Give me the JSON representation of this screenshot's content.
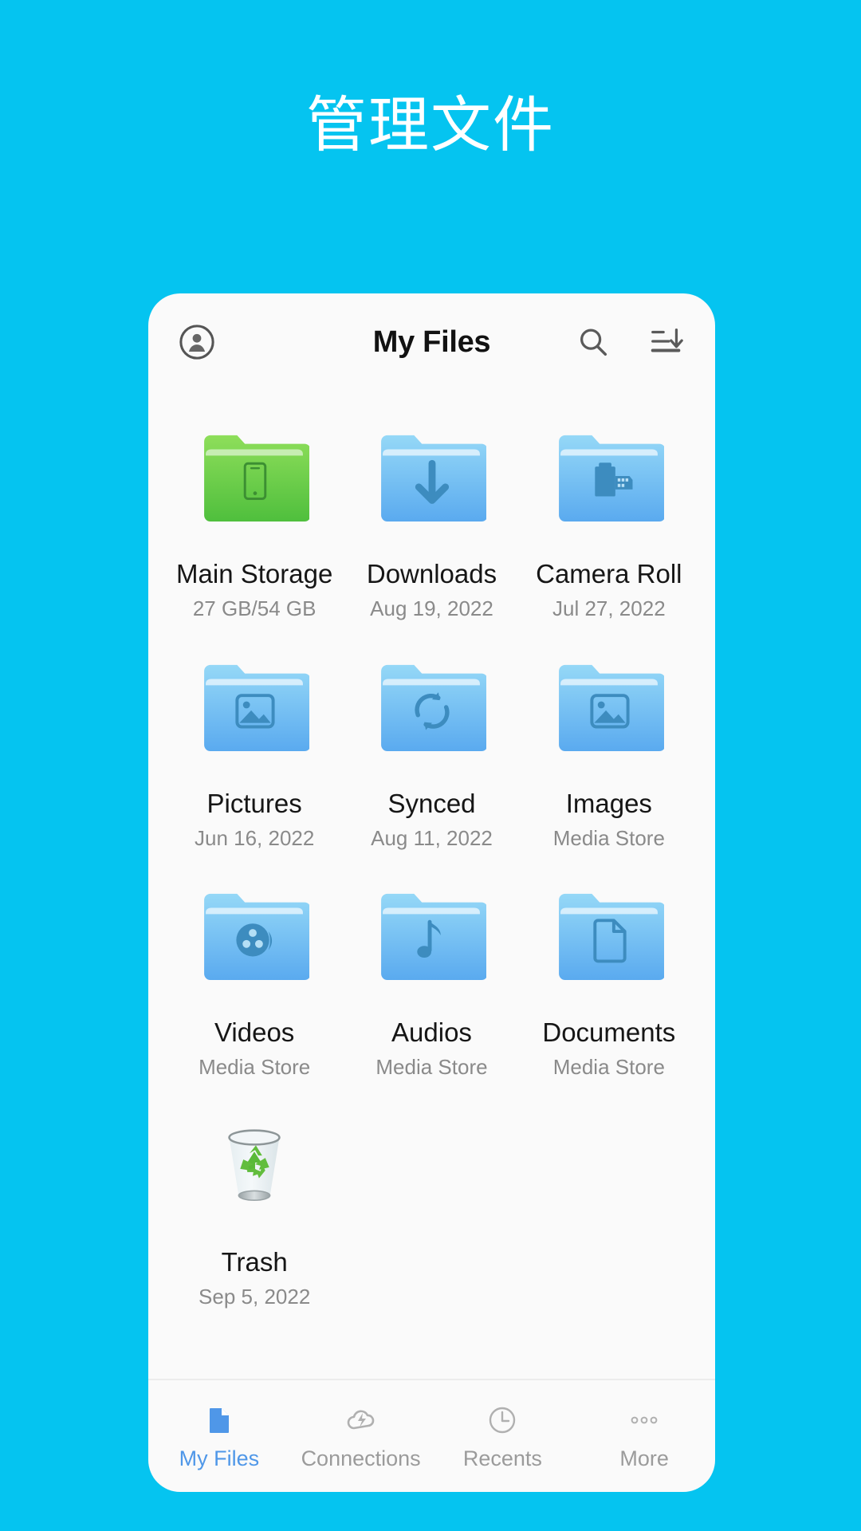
{
  "page": {
    "background_color": "#05c4f0",
    "hero_title": "管理文件"
  },
  "app_bar": {
    "avatar_icon": "account-circle-icon",
    "title": "My Files",
    "search_icon": "search-icon",
    "sort_icon": "sort-descending-icon"
  },
  "files": [
    {
      "name": "Main Storage",
      "sub": "27 GB/54 GB",
      "icon": "folder-phone-icon",
      "accent": "#5fc24a"
    },
    {
      "name": "Downloads",
      "sub": "Aug 19, 2022",
      "icon": "folder-download-icon",
      "accent": "#66b8ef"
    },
    {
      "name": "Camera Roll",
      "sub": "Jul 27, 2022",
      "icon": "folder-filmroll-icon",
      "accent": "#66b8ef"
    },
    {
      "name": "Pictures",
      "sub": "Jun 16, 2022",
      "icon": "folder-image-icon",
      "accent": "#66b8ef"
    },
    {
      "name": "Synced",
      "sub": "Aug 11, 2022",
      "icon": "folder-sync-icon",
      "accent": "#66b8ef"
    },
    {
      "name": "Images",
      "sub": "Media Store",
      "icon": "folder-image-icon",
      "accent": "#66b8ef"
    },
    {
      "name": "Videos",
      "sub": "Media Store",
      "icon": "folder-film-icon",
      "accent": "#66b8ef"
    },
    {
      "name": "Audios",
      "sub": "Media Store",
      "icon": "folder-music-icon",
      "accent": "#66b8ef"
    },
    {
      "name": "Documents",
      "sub": "Media Store",
      "icon": "folder-document-icon",
      "accent": "#66b8ef"
    },
    {
      "name": "Trash",
      "sub": "Sep 5, 2022",
      "icon": "recycle-bin-icon",
      "accent": "#6cb33f"
    }
  ],
  "bottom_nav": {
    "active_color": "#4f97e8",
    "inactive_color": "#9b9b9b",
    "items": [
      {
        "label": "My Files",
        "icon": "file-page-icon",
        "active": true
      },
      {
        "label": "Connections",
        "icon": "cloud-bolt-icon",
        "active": false
      },
      {
        "label": "Recents",
        "icon": "clock-icon",
        "active": false
      },
      {
        "label": "More",
        "icon": "more-dots-icon",
        "active": false
      }
    ]
  }
}
